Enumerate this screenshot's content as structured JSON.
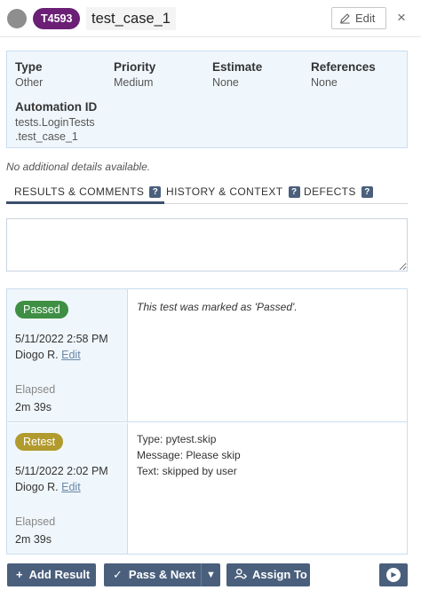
{
  "header": {
    "case_id": "T4593",
    "title": "test_case_1",
    "edit_label": "Edit",
    "close_glyph": "×",
    "status_color": "#8e8e8e",
    "id_badge_color": "#6b1f75"
  },
  "fields": {
    "type": {
      "label": "Type",
      "value": "Other"
    },
    "priority": {
      "label": "Priority",
      "value": "Medium"
    },
    "estimate": {
      "label": "Estimate",
      "value": "None"
    },
    "references": {
      "label": "References",
      "value": "None"
    },
    "automation_id": {
      "label": "Automation ID",
      "line1": "tests.LoginTests",
      "line2": ".test_case_1"
    }
  },
  "no_details": "No additional details available.",
  "tabs": [
    {
      "label": "RESULTS & COMMENTS",
      "active": true
    },
    {
      "label": "HISTORY & CONTEXT",
      "active": false
    },
    {
      "label": "DEFECTS",
      "active": false
    }
  ],
  "help_glyph": "?",
  "comment_box": {
    "value": ""
  },
  "results": [
    {
      "status": "Passed",
      "status_color": "#3e8f44",
      "timestamp": "5/11/2022 2:58 PM",
      "user": "Diogo R.",
      "edit": "Edit",
      "elapsed_label": "Elapsed",
      "elapsed": "2m 39s",
      "comment": "This test was marked as 'Passed'."
    },
    {
      "status": "Retest",
      "status_color": "#b19a2e",
      "timestamp": "5/11/2022 2:02 PM",
      "user": "Diogo R.",
      "edit": "Edit",
      "elapsed_label": "Elapsed",
      "elapsed": "2m 39s",
      "details": [
        "Type: pytest.skip",
        "Message: Please skip",
        "Text: skipped by user"
      ]
    }
  ],
  "toolbar": {
    "add_result": "Add Result",
    "pass_next": "Pass & Next",
    "assign_to": "Assign To",
    "plus_glyph": "+",
    "check_glyph": "✓",
    "caret_glyph": "▼",
    "play_glyph": "▶",
    "button_color": "#4a5f7c"
  }
}
